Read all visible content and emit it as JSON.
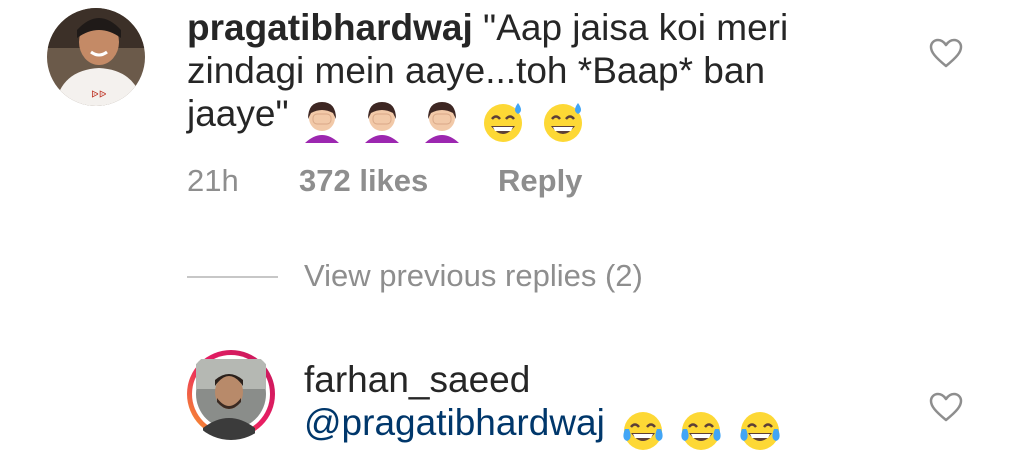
{
  "comments": [
    {
      "username": "pragatibhardwaj",
      "text_line1": " \"Aap jaisa koi meri",
      "text_line2": "zindagi mein aaye...toh *Baap* ban",
      "text_line3": "jaaye\"",
      "emojis": [
        "woman-facepalming-icon",
        "woman-facepalming-icon",
        "woman-facepalming-icon",
        "grinning-sweat-icon",
        "grinning-sweat-icon"
      ],
      "time": "21h",
      "likes": "372 likes",
      "reply_label": "Reply"
    },
    {
      "username": "farhan_saeed",
      "mention": "@pragatibhardwaj",
      "emojis": [
        "tears-of-joy-icon",
        "tears-of-joy-icon",
        "tears-of-joy-icon"
      ],
      "has_story_ring": true
    }
  ],
  "view_replies": {
    "label": "View previous replies (2)"
  },
  "colors": {
    "text": "#262626",
    "secondary": "#8e8e8e",
    "mention": "#00376b",
    "story_ring_start": "#f9a825",
    "story_ring_end": "#c2185b"
  }
}
